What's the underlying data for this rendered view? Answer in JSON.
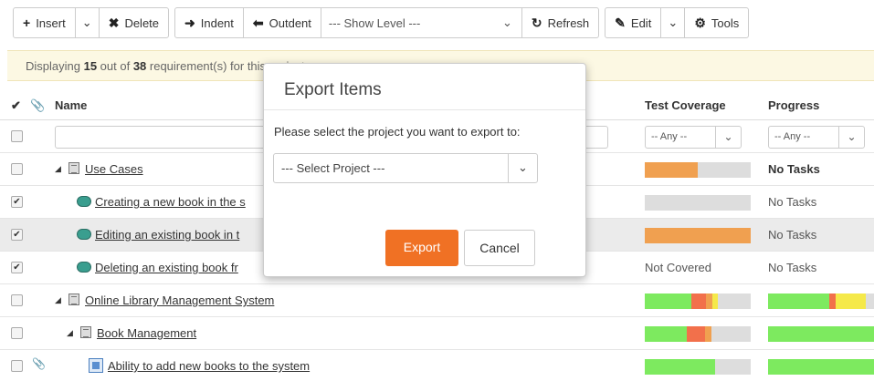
{
  "toolbar": {
    "insert": "Insert",
    "delete": "Delete",
    "indent": "Indent",
    "outdent": "Outdent",
    "show_level": "--- Show Level ---",
    "refresh": "Refresh",
    "edit": "Edit",
    "tools": "Tools"
  },
  "notice": {
    "prefix": "Displaying ",
    "shown": "15",
    "middle": " out of ",
    "total": "38",
    "suffix": " requirement(s) for this project."
  },
  "columns": {
    "name": "Name",
    "test_coverage": "Test Coverage",
    "progress": "Progress"
  },
  "filters": {
    "coverage": "-- Any --",
    "progress": "-- Any --"
  },
  "colors": {
    "orange": "#f0a050",
    "green": "#7dea5f",
    "red": "#f2704b",
    "yellow": "#f5e94a",
    "gray": "#dddddd",
    "accent": "#f07124"
  },
  "rows": [
    {
      "name": "Use Cases",
      "checked": false,
      "coverage_text": "",
      "progress_text": "No Tasks"
    },
    {
      "name": "Creating a new book in the s",
      "checked": true,
      "coverage_text": "",
      "progress_text": "No Tasks"
    },
    {
      "name": "Editing an existing book in t",
      "checked": true,
      "coverage_text": "",
      "progress_text": "No Tasks"
    },
    {
      "name": "Deleting an existing book fr",
      "checked": true,
      "coverage_text": "Not Covered",
      "progress_text": "No Tasks"
    },
    {
      "name": "Online Library Management System",
      "checked": false,
      "coverage_text": "",
      "progress_text": ""
    },
    {
      "name": "Book Management",
      "checked": false,
      "coverage_text": "",
      "progress_text": ""
    },
    {
      "name": "Ability to add new books to the system",
      "checked": false,
      "coverage_text": "",
      "progress_text": ""
    }
  ],
  "dialog": {
    "title": "Export Items",
    "text": "Please select the project you want to export to:",
    "select": "--- Select Project ---",
    "export": "Export",
    "cancel": "Cancel"
  }
}
